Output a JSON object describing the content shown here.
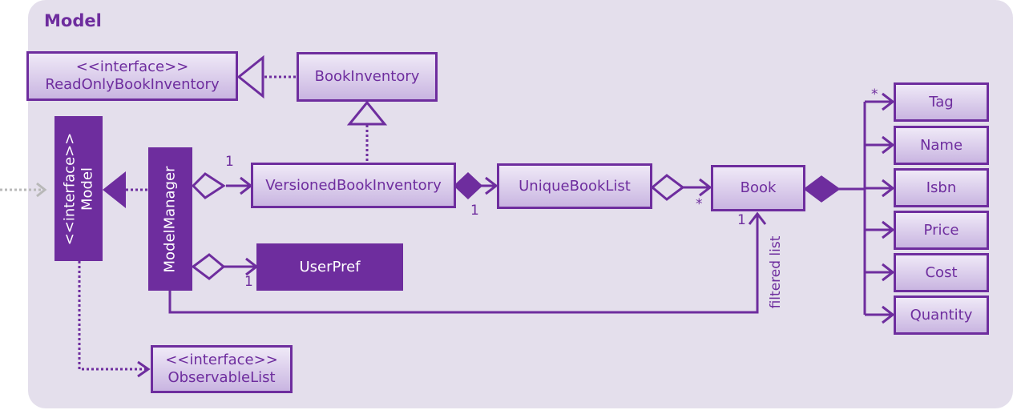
{
  "package": {
    "title": "Model"
  },
  "classes": {
    "read_only_book_inventory": {
      "stereotype": "<<interface>>",
      "name": "ReadOnlyBookInventory"
    },
    "book_inventory": {
      "name": "BookInventory"
    },
    "model": {
      "stereotype": "<<interface>>",
      "name": "Model"
    },
    "model_manager": {
      "name": "ModelManager"
    },
    "versioned_book_inventory": {
      "name": "VersionedBookInventory"
    },
    "unique_book_list": {
      "name": "UniqueBookList"
    },
    "book": {
      "name": "Book"
    },
    "user_pref": {
      "name": "UserPref"
    },
    "observable_list": {
      "stereotype": "<<interface>>",
      "name": "ObservableList"
    },
    "tag": {
      "name": "Tag"
    },
    "name": {
      "name": "Name"
    },
    "isbn": {
      "name": "Isbn"
    },
    "price": {
      "name": "Price"
    },
    "cost": {
      "name": "Cost"
    },
    "quantity": {
      "name": "Quantity"
    }
  },
  "multiplicities": {
    "manager_to_versioned": "1",
    "versioned_to_unique": "1",
    "manager_to_userpref": "1",
    "unique_to_book": "*",
    "filtered_to_book": "1",
    "book_to_tag": "*"
  },
  "labels": {
    "filtered_list": "filtered list"
  },
  "colors": {
    "primary": "#6e2d9e",
    "background": "#e4dfec",
    "box_top": "#efe9f7",
    "box_bottom": "#c9b5e1"
  }
}
